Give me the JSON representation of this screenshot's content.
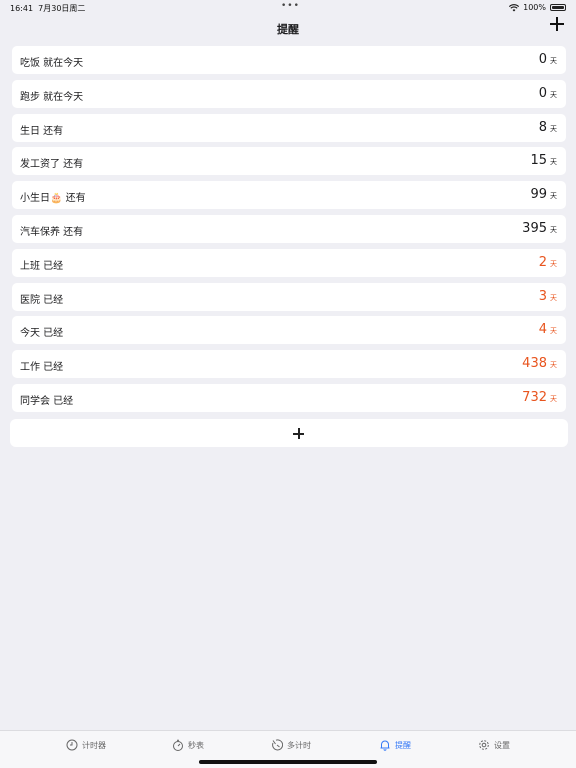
{
  "status": {
    "time": "16:41",
    "date": "7月30日周二",
    "battery": "100%"
  },
  "nav": {
    "title": "提醒"
  },
  "reminders": [
    {
      "label": "吃饭 就在今天",
      "value": "0",
      "unit": "天",
      "past": false
    },
    {
      "label": "跑步 就在今天",
      "value": "0",
      "unit": "天",
      "past": false
    },
    {
      "label": "生日 还有",
      "value": "8",
      "unit": "天",
      "past": false
    },
    {
      "label": "发工资了 还有",
      "value": "15",
      "unit": "天",
      "past": false
    },
    {
      "label": "小生日🎂 还有",
      "value": "99",
      "unit": "天",
      "past": false
    },
    {
      "label": "汽车保养 还有",
      "value": "395",
      "unit": "天",
      "past": false
    },
    {
      "label": "上班 已经",
      "value": "2",
      "unit": "天",
      "past": true
    },
    {
      "label": "医院 已经",
      "value": "3",
      "unit": "天",
      "past": true
    },
    {
      "label": "今天 已经",
      "value": "4",
      "unit": "天",
      "past": true
    },
    {
      "label": "工作 已经",
      "value": "438",
      "unit": "天",
      "past": true
    },
    {
      "label": "同学会 已经",
      "value": "732",
      "unit": "天",
      "past": true
    }
  ],
  "tabs": [
    {
      "label": "计时器",
      "icon": "clock-icon"
    },
    {
      "label": "秒表",
      "icon": "stopwatch-icon"
    },
    {
      "label": "多计时",
      "icon": "multi-timer-icon"
    },
    {
      "label": "提醒",
      "icon": "bell-icon",
      "active": true
    },
    {
      "label": "设置",
      "icon": "gear-icon"
    }
  ],
  "colors": {
    "accent": "#3478f6",
    "past": "#e8541e",
    "background": "#efeff4"
  }
}
